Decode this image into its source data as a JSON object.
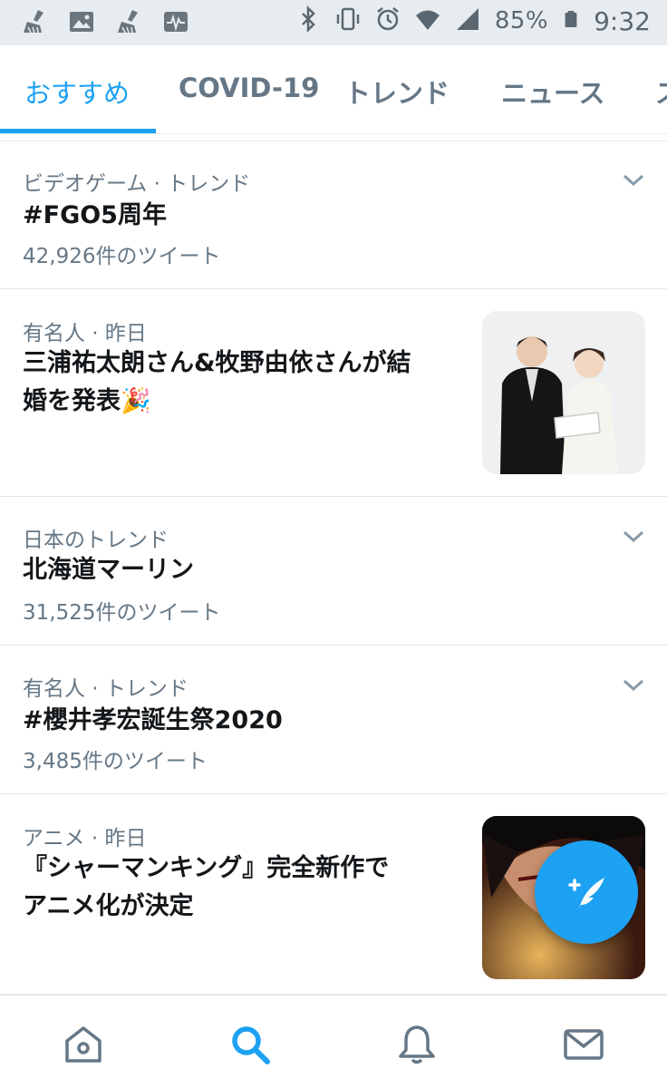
{
  "status_bar": {
    "battery_percent": "85%",
    "time": "9:32",
    "left_icons": [
      "broom-icon",
      "image-icon",
      "broom-icon",
      "activity-icon"
    ],
    "right_icons": [
      "bluetooth-icon",
      "vibrate-icon",
      "alarm-icon",
      "wifi-icon",
      "signal-icon",
      "battery-icon"
    ]
  },
  "tabs": [
    {
      "label": "おすすめ",
      "active": true
    },
    {
      "label": "COVID-19",
      "active": false
    },
    {
      "label": "トレンド",
      "active": false
    },
    {
      "label": "ニュース",
      "active": false
    },
    {
      "label": "ス",
      "active": false
    }
  ],
  "feed": [
    {
      "meta": "ビデオゲーム · トレンド",
      "title": "#FGO5周年",
      "count": "42,926件のツイート",
      "has_chevron": true
    },
    {
      "meta": "有名人 · 昨日",
      "title_line1": "三浦祐太朗さん&牧野由依さんが結",
      "title_line2": "婚を発表🎉",
      "has_thumbnail": true
    },
    {
      "meta": "日本のトレンド",
      "title": "北海道マーリン",
      "count": "31,525件のツイート",
      "has_chevron": true
    },
    {
      "meta": "有名人 · トレンド",
      "title": "#櫻井孝宏誕生祭2020",
      "count": "3,485件のツイート",
      "has_chevron": true
    },
    {
      "meta": "アニメ · 昨日",
      "title_line1": "『シャーマンキング』完全新作で",
      "title_line2": "アニメ化が決定",
      "has_thumbnail": true
    }
  ],
  "fab": {
    "icon": "compose-tweet-icon"
  },
  "bottom_nav": [
    {
      "icon": "home-icon"
    },
    {
      "icon": "search-icon",
      "active": true
    },
    {
      "icon": "notifications-bell-icon"
    },
    {
      "icon": "messages-envelope-icon"
    }
  ],
  "colors": {
    "accent": "#1da1f2",
    "secondary_text": "#657786",
    "status_bar_bg": "#e6ecf0"
  }
}
